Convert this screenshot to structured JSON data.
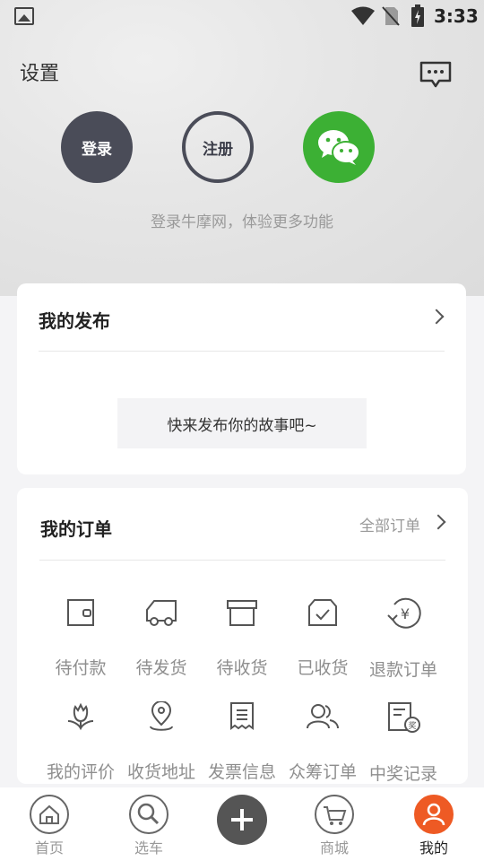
{
  "status_bar": {
    "time": "3:33"
  },
  "header": {
    "settings_label": "设置"
  },
  "auth": {
    "login_label": "登录",
    "register_label": "注册",
    "tagline": "登录牛摩网，体验更多功能"
  },
  "my_posts": {
    "title": "我的发布",
    "empty_button": "快来发布你的故事吧~"
  },
  "my_orders": {
    "title": "我的订单",
    "all_orders_label": "全部订单",
    "items": [
      {
        "label": "待付款",
        "icon": "wallet-icon"
      },
      {
        "label": "待发货",
        "icon": "truck-icon"
      },
      {
        "label": "待收货",
        "icon": "box-icon"
      },
      {
        "label": "已收货",
        "icon": "received-box-icon"
      },
      {
        "label": "退款订单",
        "icon": "refund-icon"
      },
      {
        "label": "我的评价",
        "icon": "flower-icon"
      },
      {
        "label": "收货地址",
        "icon": "location-pin-icon"
      },
      {
        "label": "发票信息",
        "icon": "invoice-icon"
      },
      {
        "label": "众筹订单",
        "icon": "group-icon"
      },
      {
        "label": "中奖记录",
        "icon": "prize-record-icon"
      }
    ]
  },
  "tabbar": {
    "tabs": [
      {
        "label": "首页",
        "icon": "home-icon"
      },
      {
        "label": "选车",
        "icon": "search-icon"
      },
      {
        "label": "",
        "icon": "plus-icon"
      },
      {
        "label": "商城",
        "icon": "cart-icon"
      },
      {
        "label": "我的",
        "icon": "user-icon"
      }
    ],
    "active_tab": "我的",
    "accent_color": "#ee5a24"
  }
}
